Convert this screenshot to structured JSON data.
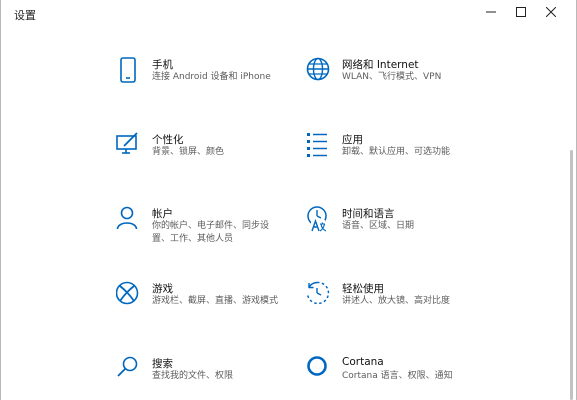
{
  "window": {
    "title": "设置",
    "accent": "#0067c0"
  },
  "tiles": [
    {
      "name": "手机",
      "desc": "连接 Android 设备和 iPhone",
      "icon": "phone-icon"
    },
    {
      "name": "网络和 Internet",
      "desc": "WLAN、飞行模式、VPN",
      "icon": "globe-icon"
    },
    {
      "name": "个性化",
      "desc": "背景、锁屏、颜色",
      "icon": "personalization-icon"
    },
    {
      "name": "应用",
      "desc": "卸载、默认应用、可选功能",
      "icon": "apps-list-icon"
    },
    {
      "name": "帐户",
      "desc": "你的帐户、电子邮件、同步设置、工作、其他人员",
      "icon": "account-icon"
    },
    {
      "name": "时间和语言",
      "desc": "语音、区域、日期",
      "icon": "time-language-icon"
    },
    {
      "name": "游戏",
      "desc": "游戏栏、截屏、直播、游戏模式",
      "icon": "xbox-icon"
    },
    {
      "name": "轻松使用",
      "desc": "讲述人、放大镜、高对比度",
      "icon": "ease-of-access-icon"
    },
    {
      "name": "搜索",
      "desc": "查找我的文件、权限",
      "icon": "search-icon"
    },
    {
      "name": "Cortana",
      "desc": "Cortana 语言、权限、通知",
      "icon": "cortana-icon"
    }
  ]
}
